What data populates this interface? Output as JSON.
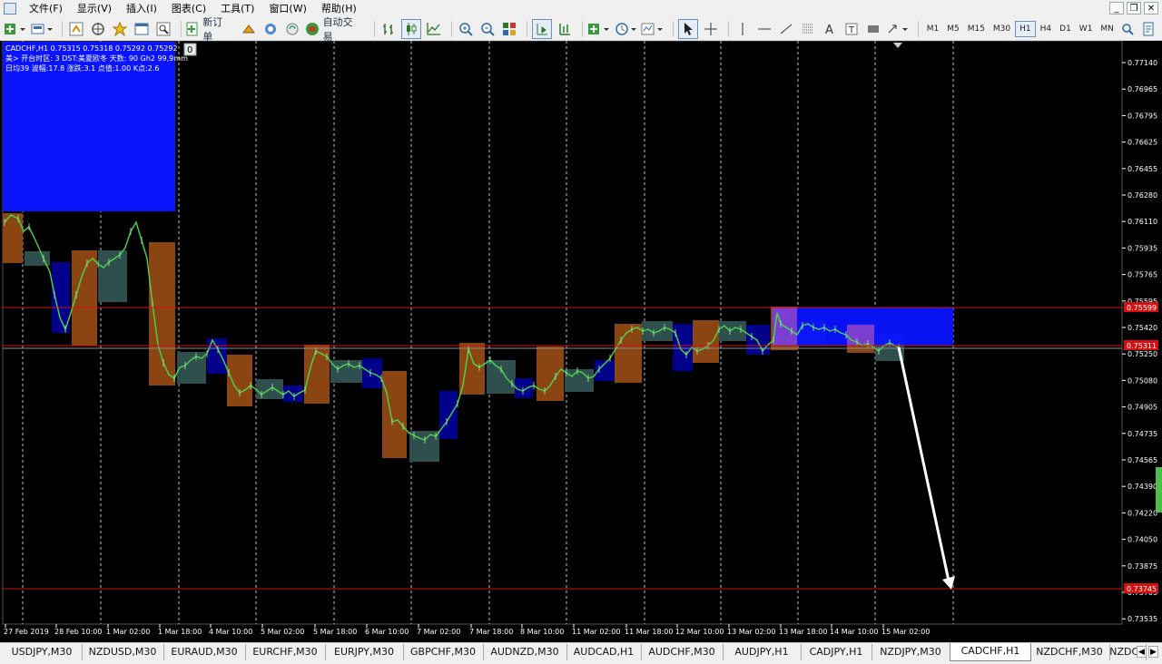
{
  "menu": {
    "items": [
      "文件(F)",
      "显示(V)",
      "插入(I)",
      "图表(C)",
      "工具(T)",
      "窗口(W)",
      "帮助(H)"
    ]
  },
  "toolbar": {
    "new_order_label": "新订单",
    "auto_trade_label": "自动交易",
    "timeframes": [
      "M1",
      "M5",
      "M15",
      "M30",
      "H1",
      "H4",
      "D1",
      "W1",
      "MN"
    ],
    "active_timeframe": "H1"
  },
  "chart": {
    "header_line1": "CADCHF,H1  0.75315 0.75318 0.75292 0.75292",
    "header_line2": "美> 开台时区: 3  DST:美夏欧冬 天数: 90  Gh2  99,9mm",
    "header_line3": "日均39  波幅:17.8  涨跌:3.1  点值:1.00  K点:2.6",
    "indicator_badge": "0",
    "price_labels": [
      "0.77140",
      "0.76965",
      "0.76795",
      "0.76625",
      "0.76455",
      "0.76280",
      "0.76110",
      "0.75935",
      "0.75765",
      "0.75595",
      "0.75420",
      "0.75250",
      "0.75080",
      "0.74905",
      "0.74735",
      "0.74565",
      "0.74390",
      "0.74220",
      "0.74050",
      "0.73875",
      "0.73705",
      "0.73535"
    ],
    "time_labels": [
      "27 Feb 2019",
      "28 Feb 10:00",
      "1 Mar 02:00",
      "1 Mar 18:00",
      "4 Mar 10:00",
      "5 Mar 02:00",
      "5 Mar 18:00",
      "6 Mar 10:00",
      "7 Mar 02:00",
      "7 Mar 18:00",
      "8 Mar 10:00",
      "11 Mar 02:00",
      "11 Mar 18:00",
      "12 Mar 10:00",
      "13 Mar 02:00",
      "13 Mar 18:00",
      "14 Mar 10:00",
      "15 Mar 02:00"
    ],
    "hline_high": "0.75599",
    "hline_current": "0.75311",
    "hline_target": "0.73745",
    "current_price": "0.75292"
  },
  "tabs": [
    "USDJPY,M30",
    "NZDUSD,M30",
    "EURAUD,M30",
    "EURCHF,M30",
    "EURJPY,M30",
    "GBPCHF,M30",
    "AUDNZD,M30",
    "AUDCAD,H1",
    "AUDCHF,M30",
    "AUDJPY,H1",
    "CADJPY,H1",
    "NZDJPY,M30",
    "CADCHF,H1",
    "NZDCHF,M30",
    "NZDCA"
  ],
  "active_tab": "CADCHF,H1"
}
